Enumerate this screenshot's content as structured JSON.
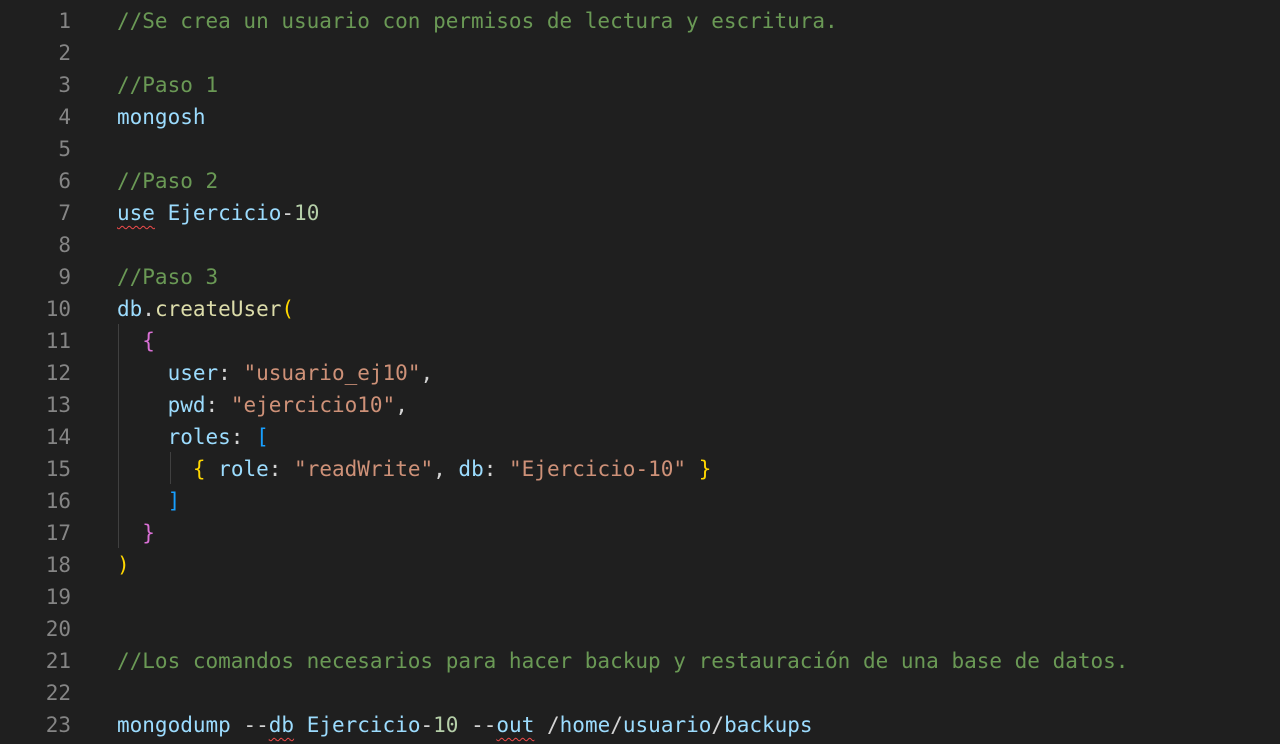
{
  "editor": {
    "lines": [
      {
        "n": "1",
        "tokens": [
          {
            "t": "//Se crea un usuario con permisos de lectura y escritura.",
            "c": "cm"
          }
        ]
      },
      {
        "n": "2",
        "tokens": []
      },
      {
        "n": "3",
        "tokens": [
          {
            "t": "//Paso 1",
            "c": "cm"
          }
        ]
      },
      {
        "n": "4",
        "tokens": [
          {
            "t": "mongosh",
            "c": "id"
          }
        ]
      },
      {
        "n": "5",
        "tokens": []
      },
      {
        "n": "6",
        "tokens": [
          {
            "t": "//Paso 2",
            "c": "cm"
          }
        ]
      },
      {
        "n": "7",
        "tokens": [
          {
            "t": "use",
            "c": "id",
            "squig": true
          },
          {
            "t": " ",
            "c": "pl"
          },
          {
            "t": "Ejercicio",
            "c": "id"
          },
          {
            "t": "-",
            "c": "pl"
          },
          {
            "t": "10",
            "c": "num"
          }
        ]
      },
      {
        "n": "8",
        "tokens": []
      },
      {
        "n": "9",
        "tokens": [
          {
            "t": "//Paso 3",
            "c": "cm"
          }
        ]
      },
      {
        "n": "10",
        "tokens": [
          {
            "t": "db",
            "c": "id"
          },
          {
            "t": ".",
            "c": "pl"
          },
          {
            "t": "createUser",
            "c": "fn"
          },
          {
            "t": "(",
            "c": "b1"
          }
        ]
      },
      {
        "n": "11",
        "tokens": [
          {
            "t": "  ",
            "c": "pl"
          },
          {
            "t": "{",
            "c": "b2"
          }
        ]
      },
      {
        "n": "12",
        "tokens": [
          {
            "t": "    ",
            "c": "pl"
          },
          {
            "t": "user",
            "c": "id"
          },
          {
            "t": ": ",
            "c": "pl"
          },
          {
            "t": "\"usuario_ej10\"",
            "c": "st"
          },
          {
            "t": ",",
            "c": "pl"
          }
        ]
      },
      {
        "n": "13",
        "tokens": [
          {
            "t": "    ",
            "c": "pl"
          },
          {
            "t": "pwd",
            "c": "id"
          },
          {
            "t": ": ",
            "c": "pl"
          },
          {
            "t": "\"ejercicio10\"",
            "c": "st"
          },
          {
            "t": ",",
            "c": "pl"
          }
        ]
      },
      {
        "n": "14",
        "tokens": [
          {
            "t": "    ",
            "c": "pl"
          },
          {
            "t": "roles",
            "c": "id"
          },
          {
            "t": ": ",
            "c": "pl"
          },
          {
            "t": "[",
            "c": "b3"
          }
        ]
      },
      {
        "n": "15",
        "tokens": [
          {
            "t": "      ",
            "c": "pl"
          },
          {
            "t": "{",
            "c": "b1"
          },
          {
            "t": " ",
            "c": "pl"
          },
          {
            "t": "role",
            "c": "id"
          },
          {
            "t": ": ",
            "c": "pl"
          },
          {
            "t": "\"readWrite\"",
            "c": "st"
          },
          {
            "t": ", ",
            "c": "pl"
          },
          {
            "t": "db",
            "c": "id"
          },
          {
            "t": ": ",
            "c": "pl"
          },
          {
            "t": "\"Ejercicio-10\"",
            "c": "st"
          },
          {
            "t": " ",
            "c": "pl"
          },
          {
            "t": "}",
            "c": "b1"
          }
        ]
      },
      {
        "n": "16",
        "tokens": [
          {
            "t": "    ",
            "c": "pl"
          },
          {
            "t": "]",
            "c": "b3"
          }
        ]
      },
      {
        "n": "17",
        "tokens": [
          {
            "t": "  ",
            "c": "pl"
          },
          {
            "t": "}",
            "c": "b2"
          }
        ]
      },
      {
        "n": "18",
        "tokens": [
          {
            "t": ")",
            "c": "b1"
          }
        ]
      },
      {
        "n": "19",
        "tokens": []
      },
      {
        "n": "20",
        "tokens": []
      },
      {
        "n": "21",
        "tokens": [
          {
            "t": "//Los comandos necesarios para hacer backup y restauración de una base de datos.",
            "c": "cm"
          }
        ]
      },
      {
        "n": "22",
        "tokens": []
      },
      {
        "n": "23",
        "tokens": [
          {
            "t": "mongodump",
            "c": "id"
          },
          {
            "t": " ",
            "c": "pl"
          },
          {
            "t": "--",
            "c": "pl"
          },
          {
            "t": "db",
            "c": "id",
            "squig": true
          },
          {
            "t": " ",
            "c": "pl"
          },
          {
            "t": "Ejercicio",
            "c": "id"
          },
          {
            "t": "-",
            "c": "pl"
          },
          {
            "t": "10",
            "c": "num"
          },
          {
            "t": " ",
            "c": "pl"
          },
          {
            "t": "--",
            "c": "pl"
          },
          {
            "t": "out",
            "c": "id",
            "squig": true
          },
          {
            "t": " ",
            "c": "pl"
          },
          {
            "t": "/",
            "c": "pl"
          },
          {
            "t": "home",
            "c": "id"
          },
          {
            "t": "/",
            "c": "pl"
          },
          {
            "t": "usuario",
            "c": "id"
          },
          {
            "t": "/",
            "c": "pl"
          },
          {
            "t": "backups",
            "c": "id"
          }
        ]
      }
    ]
  }
}
